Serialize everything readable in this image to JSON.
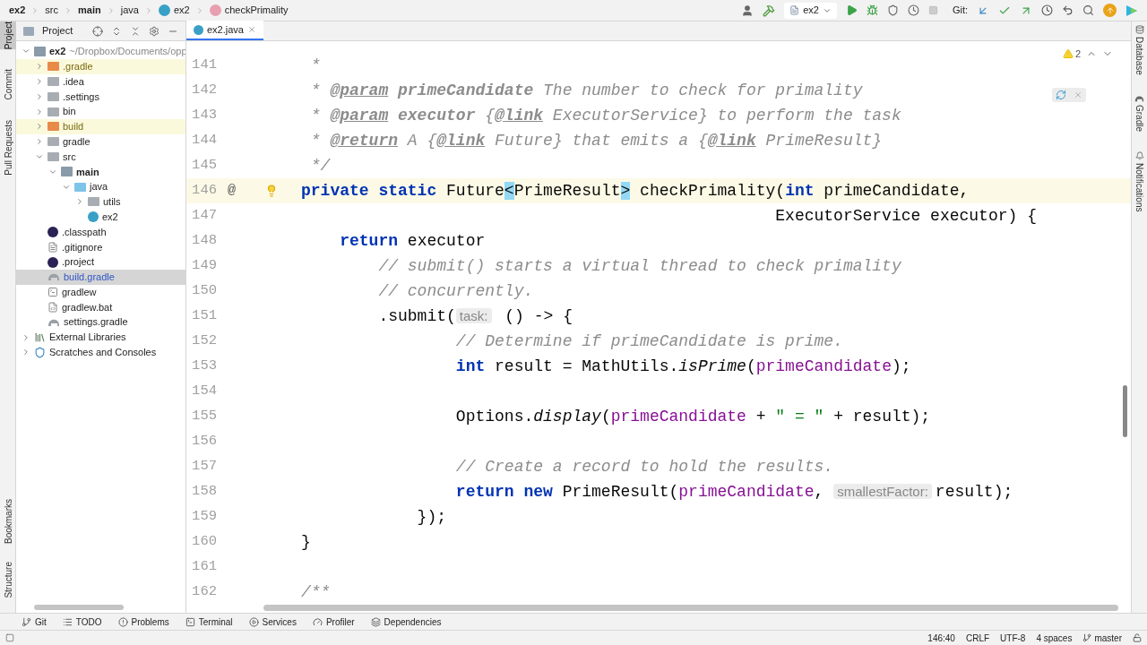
{
  "breadcrumbs": [
    {
      "label": "ex2",
      "bold": true,
      "kind": "plain"
    },
    {
      "label": "src",
      "bold": false,
      "kind": "plain"
    },
    {
      "label": "main",
      "bold": true,
      "kind": "plain"
    },
    {
      "label": "java",
      "bold": false,
      "kind": "plain"
    },
    {
      "label": "ex2",
      "bold": false,
      "kind": "class"
    },
    {
      "label": "checkPrimality",
      "bold": false,
      "kind": "method"
    }
  ],
  "toolbar": {
    "run_config": "ex2",
    "git_label": "Git:",
    "stop": {
      "disabled": true
    }
  },
  "left_strip": {
    "top": [
      {
        "label": "Project",
        "selected": true
      },
      {
        "label": "Commit",
        "selected": false
      },
      {
        "label": "Pull Requests",
        "selected": false
      }
    ],
    "bottom": [
      {
        "label": "Bookmarks",
        "selected": false
      },
      {
        "label": "Structure",
        "selected": false
      }
    ]
  },
  "project_panel": {
    "title": "Project",
    "tree": [
      {
        "label": "ex2",
        "note": "~/Dropbox/Documents/opp",
        "kind": "module",
        "expanded": true,
        "selected": false,
        "children": [
          {
            "label": ".gradle",
            "kind": "folder",
            "excluded": true,
            "expanded": false,
            "selected": false
          },
          {
            "label": ".idea",
            "kind": "folder",
            "expanded": false,
            "selected": false
          },
          {
            "label": ".settings",
            "kind": "folder",
            "expanded": false,
            "selected": false
          },
          {
            "label": "bin",
            "kind": "folder",
            "expanded": false,
            "selected": false
          },
          {
            "label": "build",
            "kind": "folder",
            "excluded": true,
            "expanded": false,
            "selected": false
          },
          {
            "label": "gradle",
            "kind": "folder",
            "expanded": false,
            "selected": false
          },
          {
            "label": "src",
            "kind": "folder",
            "expanded": true,
            "selected": false,
            "children": [
              {
                "label": "main",
                "kind": "module",
                "bold": true,
                "expanded": true,
                "selected": false,
                "children": [
                  {
                    "label": "java",
                    "kind": "source",
                    "expanded": true,
                    "selected": false,
                    "children": [
                      {
                        "label": "utils",
                        "kind": "package",
                        "expanded": false,
                        "selected": false
                      },
                      {
                        "label": "ex2",
                        "kind": "class",
                        "selected": false
                      }
                    ]
                  }
                ]
              }
            ]
          },
          {
            "label": ".classpath",
            "kind": "eclipse",
            "selected": false
          },
          {
            "label": ".gitignore",
            "kind": "gitignore",
            "selected": false
          },
          {
            "label": ".project",
            "kind": "eclipse",
            "selected": false
          },
          {
            "label": "build.gradle",
            "kind": "gradle",
            "modified": true,
            "selected": true
          },
          {
            "label": "gradlew",
            "kind": "script",
            "selected": false
          },
          {
            "label": "gradlew.bat",
            "kind": "bat",
            "selected": false
          },
          {
            "label": "settings.gradle",
            "kind": "gradle",
            "selected": false
          }
        ]
      },
      {
        "label": "External Libraries",
        "kind": "libraries",
        "expanded": false,
        "selected": false
      },
      {
        "label": "Scratches and Consoles",
        "kind": "scratches",
        "expanded": false,
        "selected": false
      }
    ]
  },
  "editor": {
    "tabs": [
      {
        "label": "ex2.java",
        "selected": true
      }
    ],
    "warnings": "2",
    "lines": [
      {
        "number": "141",
        "tokens": [
          {
            "kind": "comment",
            "text": " *"
          }
        ]
      },
      {
        "number": "142",
        "tokens": [
          {
            "kind": "comment",
            "text": " * "
          },
          {
            "kind": "doc-tag",
            "text": "@param"
          },
          {
            "kind": "doc-param",
            "text": " primeCandidate"
          },
          {
            "kind": "comment",
            "text": " The number to check for primality"
          }
        ]
      },
      {
        "number": "143",
        "tokens": [
          {
            "kind": "comment",
            "text": " * "
          },
          {
            "kind": "doc-tag",
            "text": "@param"
          },
          {
            "kind": "doc-param",
            "text": " executor"
          },
          {
            "kind": "comment",
            "text": " {"
          },
          {
            "kind": "doc-tag",
            "text": "@link"
          },
          {
            "kind": "comment",
            "text": " ExecutorService} to perform the task"
          }
        ]
      },
      {
        "number": "144",
        "tokens": [
          {
            "kind": "comment",
            "text": " * "
          },
          {
            "kind": "doc-tag",
            "text": "@return"
          },
          {
            "kind": "comment",
            "text": " A {"
          },
          {
            "kind": "doc-tag",
            "text": "@link"
          },
          {
            "kind": "comment",
            "text": " Future} that emits a {"
          },
          {
            "kind": "doc-tag",
            "text": "@link"
          },
          {
            "kind": "comment",
            "text": " PrimeResult}"
          }
        ]
      },
      {
        "number": "145",
        "tokens": [
          {
            "kind": "comment",
            "text": " */"
          }
        ]
      },
      {
        "number": "146",
        "current": true,
        "gutter_mark": "@",
        "tokens": [
          {
            "kind": "keyword",
            "text": "private static"
          },
          {
            "kind": "plain",
            "text": " Future"
          },
          {
            "kind": "brace",
            "text": "<"
          },
          {
            "kind": "plain",
            "text": "PrimeResult"
          },
          {
            "kind": "brace",
            "text": ">"
          },
          {
            "kind": "plain",
            "text": " checkPrimality("
          },
          {
            "kind": "keyword",
            "text": "int"
          },
          {
            "kind": "plain",
            "text": " primeCandidate,"
          }
        ]
      },
      {
        "number": "147",
        "tokens": [
          {
            "kind": "plain",
            "text": "                                                 ExecutorService executor) {"
          }
        ]
      },
      {
        "number": "148",
        "tokens": [
          {
            "kind": "keyword",
            "text": "    return"
          },
          {
            "kind": "plain",
            "text": " executor"
          }
        ]
      },
      {
        "number": "149",
        "tokens": [
          {
            "kind": "comment",
            "text": "        // submit() starts a virtual thread to check primality"
          }
        ]
      },
      {
        "number": "150",
        "tokens": [
          {
            "kind": "comment",
            "text": "        // concurrently."
          }
        ]
      },
      {
        "number": "151",
        "tokens": [
          {
            "kind": "plain",
            "text": "        .submit("
          },
          {
            "kind": "hint",
            "text": "task:"
          },
          {
            "kind": "plain",
            "text": " () -> {"
          }
        ]
      },
      {
        "number": "152",
        "tokens": [
          {
            "kind": "comment",
            "text": "                // Determine if primeCandidate is prime."
          }
        ]
      },
      {
        "number": "153",
        "tokens": [
          {
            "kind": "keyword",
            "text": "                int"
          },
          {
            "kind": "plain",
            "text": " result = MathUtils."
          },
          {
            "kind": "static",
            "text": "isPrime"
          },
          {
            "kind": "plain",
            "text": "("
          },
          {
            "kind": "param",
            "text": "primeCandidate"
          },
          {
            "kind": "plain",
            "text": ");"
          }
        ]
      },
      {
        "number": "154"
      },
      {
        "number": "155",
        "tokens": [
          {
            "kind": "plain",
            "text": "                Options."
          },
          {
            "kind": "static",
            "text": "display"
          },
          {
            "kind": "plain",
            "text": "("
          },
          {
            "kind": "param",
            "text": "primeCandidate"
          },
          {
            "kind": "plain",
            "text": " + "
          },
          {
            "kind": "string",
            "text": "\" = \""
          },
          {
            "kind": "plain",
            "text": " + result);"
          }
        ]
      },
      {
        "number": "156"
      },
      {
        "number": "157",
        "tokens": [
          {
            "kind": "comment",
            "text": "                // Create a record to hold the results."
          }
        ]
      },
      {
        "number": "158",
        "tokens": [
          {
            "kind": "keyword",
            "text": "                return new"
          },
          {
            "kind": "plain",
            "text": " PrimeResult("
          },
          {
            "kind": "param",
            "text": "primeCandidate"
          },
          {
            "kind": "plain",
            "text": ", "
          },
          {
            "kind": "hint",
            "text": "smallestFactor:"
          },
          {
            "kind": "plain",
            "text": "result);"
          }
        ]
      },
      {
        "number": "159",
        "tokens": [
          {
            "kind": "plain",
            "text": "            });"
          }
        ]
      },
      {
        "number": "160",
        "tokens": [
          {
            "kind": "plain",
            "text": "}"
          }
        ]
      },
      {
        "number": "161"
      },
      {
        "number": "162",
        "tokens": [
          {
            "kind": "comment",
            "text": "/**"
          }
        ]
      }
    ]
  },
  "right_strip": [
    {
      "label": "Database",
      "kind": "database"
    },
    {
      "label": "Gradle",
      "kind": "gradle"
    },
    {
      "label": "Notifications",
      "kind": "bell"
    }
  ],
  "tool_windows": [
    {
      "label": "Git",
      "kind": "git"
    },
    {
      "label": "TODO",
      "kind": "list"
    },
    {
      "label": "Problems",
      "kind": "problems"
    },
    {
      "label": "Terminal",
      "kind": "terminal"
    },
    {
      "label": "Services",
      "kind": "services"
    },
    {
      "label": "Profiler",
      "kind": "profiler"
    },
    {
      "label": "Dependencies",
      "kind": "layers"
    }
  ],
  "status_bar": {
    "items": [
      "146:40",
      "CRLF",
      "UTF-8",
      "4 spaces"
    ],
    "branch": "master"
  }
}
